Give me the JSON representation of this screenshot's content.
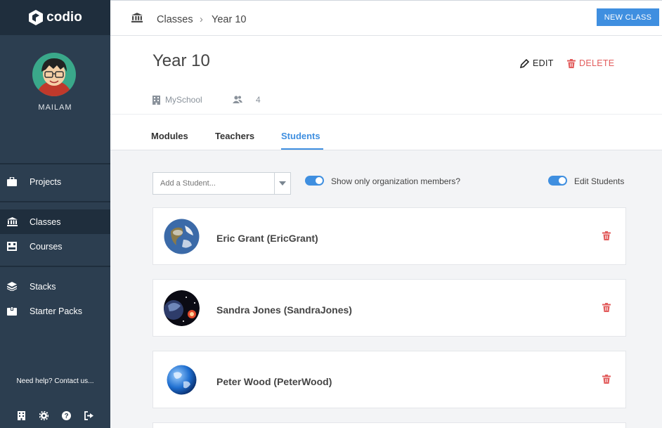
{
  "app": {
    "logo_text": "codio"
  },
  "sidebar": {
    "username": "MAILAM",
    "items": [
      {
        "label": "Projects",
        "icon": "briefcase-icon"
      },
      {
        "label": "Classes",
        "icon": "institution-icon",
        "active": true
      },
      {
        "label": "Courses",
        "icon": "courses-icon"
      },
      {
        "label": "Stacks",
        "icon": "stack-layers-icon"
      },
      {
        "label": "Starter Packs",
        "icon": "package-icon"
      }
    ],
    "help_text": "Need help? Contact us...",
    "bottom_icons": [
      "building-icon",
      "gear-icon",
      "question-icon",
      "sign-out-icon"
    ]
  },
  "topbar": {
    "breadcrumb": [
      "Classes",
      "Year 10"
    ],
    "new_class_label": "NEW CLASS"
  },
  "class": {
    "title": "Year 10",
    "edit_label": "EDIT",
    "delete_label": "DELETE",
    "school": "MySchool",
    "student_count": "4"
  },
  "tabs": [
    "Modules",
    "Teachers",
    "Students"
  ],
  "active_tab": "Students",
  "students_panel": {
    "add_placeholder": "Add a Student...",
    "toggle_org_label": "Show only organization members?",
    "toggle_org_on": true,
    "toggle_edit_label": "Edit Students",
    "toggle_edit_on": true
  },
  "students": [
    {
      "name": "Eric Grant (EricGrant)",
      "avatar": "earth-photo"
    },
    {
      "name": "Sandra Jones (SandraJones)",
      "avatar": "space-photo"
    },
    {
      "name": "Peter Wood (PeterWood)",
      "avatar": "blue-globe"
    }
  ],
  "colors": {
    "sidebar": "#2c3e50",
    "sidebar_dark": "#1f2e3d",
    "accent": "#3f8fe0",
    "danger": "#e25c5c"
  }
}
